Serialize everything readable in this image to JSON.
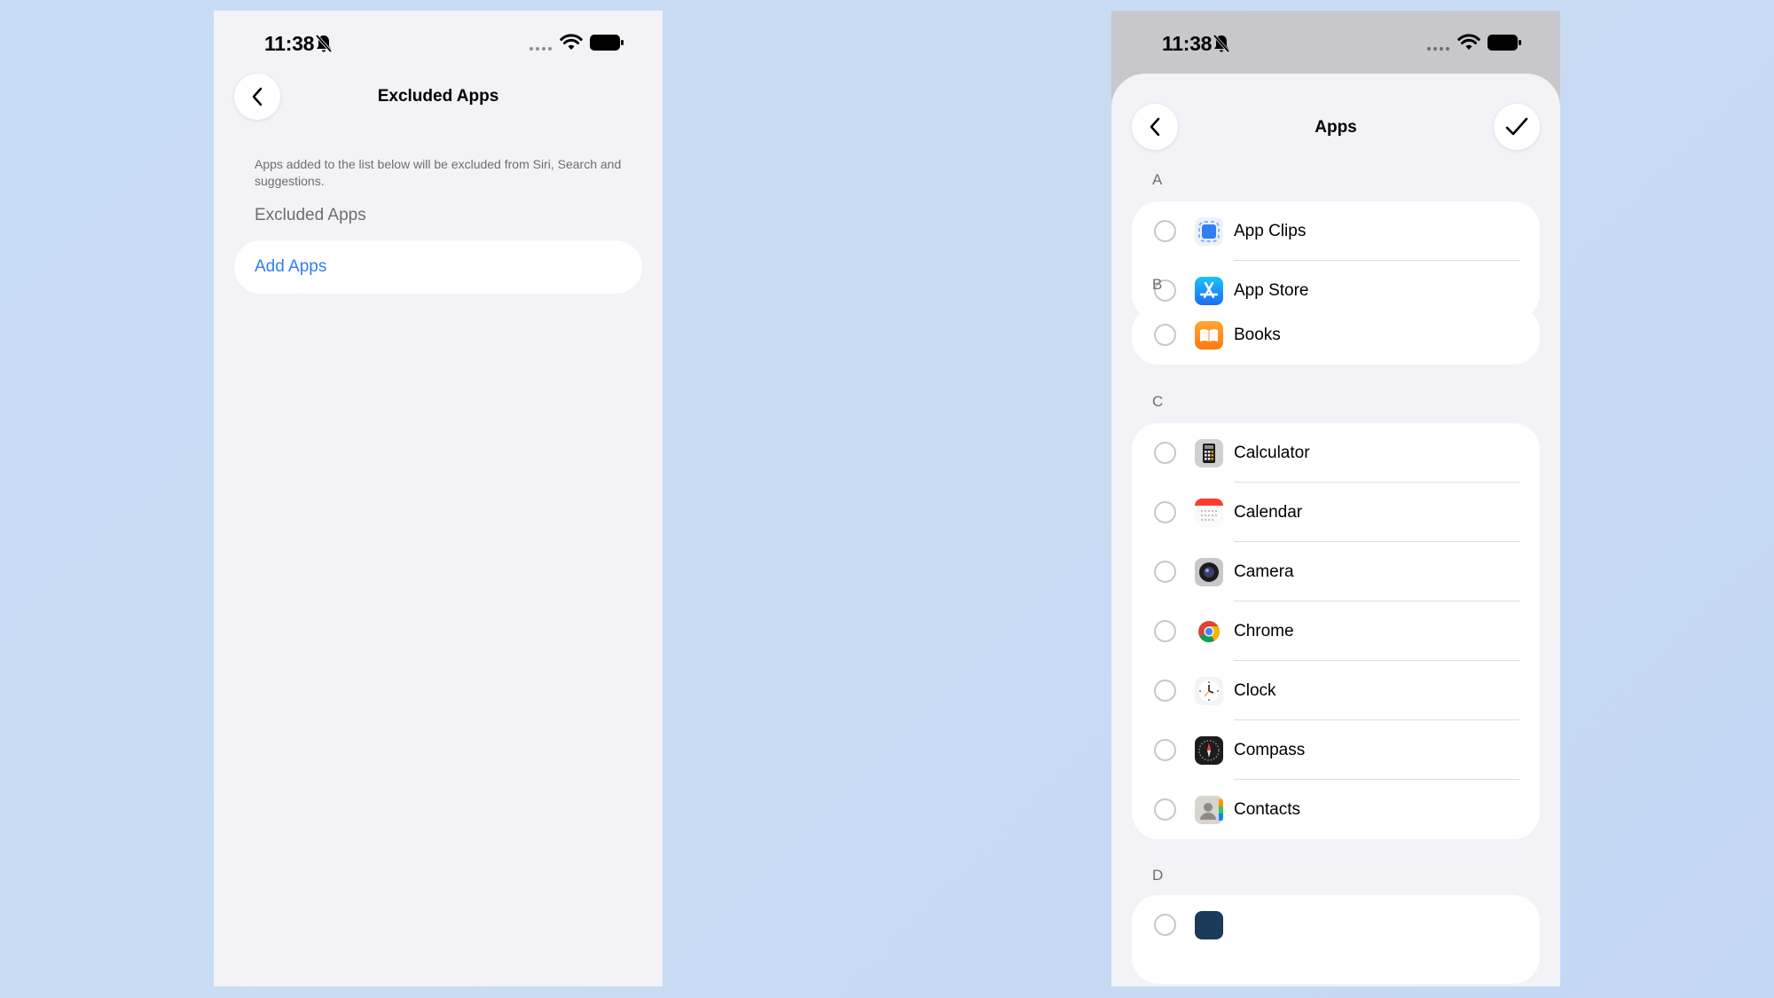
{
  "status": {
    "time": "11:38"
  },
  "left": {
    "title": "Excluded Apps",
    "description": "Apps added to the list below will be excluded from Siri, Search and suggestions.",
    "section_header": "Excluded Apps",
    "add_apps_label": "Add Apps"
  },
  "right": {
    "title": "Apps",
    "sections": [
      {
        "letter": "A",
        "apps": [
          {
            "name": "App Clips",
            "icon": "app-clips-icon"
          },
          {
            "name": "App Store",
            "icon": "app-store-icon"
          }
        ]
      },
      {
        "letter": "B",
        "apps": [
          {
            "name": "Books",
            "icon": "books-icon"
          }
        ]
      },
      {
        "letter": "C",
        "apps": [
          {
            "name": "Calculator",
            "icon": "calculator-icon"
          },
          {
            "name": "Calendar",
            "icon": "calendar-icon"
          },
          {
            "name": "Camera",
            "icon": "camera-icon"
          },
          {
            "name": "Chrome",
            "icon": "chrome-icon"
          },
          {
            "name": "Clock",
            "icon": "clock-icon"
          },
          {
            "name": "Compass",
            "icon": "compass-icon"
          },
          {
            "name": "Contacts",
            "icon": "contacts-icon"
          }
        ]
      },
      {
        "letter": "D",
        "apps": []
      }
    ]
  },
  "colors": {
    "accent": "#2f7ff0",
    "background": "#f2f2f7"
  }
}
